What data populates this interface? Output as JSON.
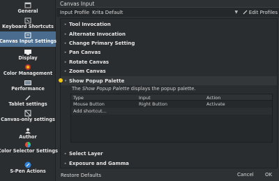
{
  "sidebar": {
    "items": [
      {
        "label": "General",
        "icon": "general-icon"
      },
      {
        "label": "Keyboard Shortcuts",
        "icon": "keyboard-icon"
      },
      {
        "label": "Canvas Input Settings",
        "icon": "canvas-input-icon",
        "active": true
      },
      {
        "label": "Display",
        "icon": "display-icon"
      },
      {
        "label": "Color Management",
        "icon": "color-management-icon"
      },
      {
        "label": "Performance",
        "icon": "performance-icon"
      },
      {
        "label": "Tablet settings",
        "icon": "tablet-icon"
      },
      {
        "label": "Canvas-only settings",
        "icon": "canvas-only-icon"
      },
      {
        "label": "Author",
        "icon": "author-icon"
      },
      {
        "label": "Color Selector Settings",
        "icon": "color-selector-icon"
      },
      {
        "label": "S-Pen Actions",
        "icon": "s-pen-icon"
      }
    ]
  },
  "main": {
    "title": "Canvas Input",
    "profile_label": "Input Profile",
    "profile_value": "Krita Default",
    "edit_profiles": "Edit Profiles",
    "tree": [
      {
        "label": "Tool Invocation"
      },
      {
        "label": "Alternate Invocation"
      },
      {
        "label": "Change Primary Setting"
      },
      {
        "label": "Pan Canvas"
      },
      {
        "label": "Rotate Canvas"
      },
      {
        "label": "Zoom Canvas"
      },
      {
        "label": "Show Popup Palette",
        "expanded": true
      },
      {
        "label": "Select Layer"
      },
      {
        "label": "Exposure and Gamma"
      }
    ],
    "description_prefix": "The ",
    "description_italic": "Show Popup Palette",
    "description_suffix": " displays the popup palette.",
    "table": {
      "headers": [
        "Type",
        "Input",
        "Action"
      ],
      "rows": [
        [
          "Mouse Button",
          "Right Button",
          "Activate"
        ],
        [
          "Add shortcut...",
          "",
          ""
        ]
      ]
    }
  },
  "footer": {
    "restore_defaults": "Restore Defaults",
    "cancel": "Cancel",
    "ok": "OK"
  },
  "colors": {
    "accent": "#4a6c8f",
    "background": "#2e3134",
    "cursor": "#f2c713"
  }
}
